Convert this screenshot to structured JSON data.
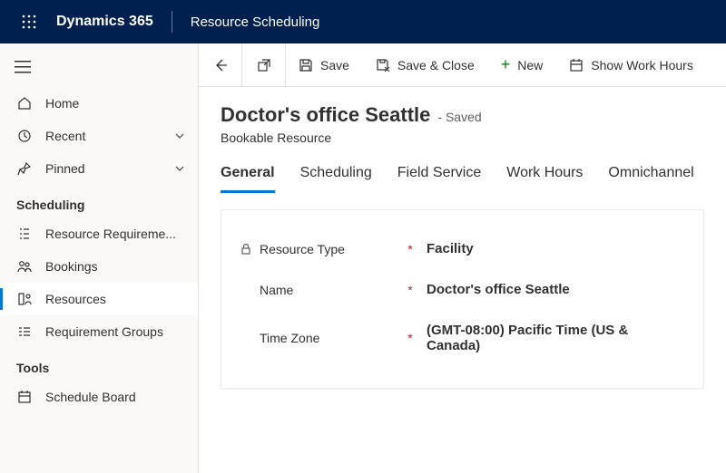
{
  "topbar": {
    "brand": "Dynamics 365",
    "app": "Resource Scheduling"
  },
  "sidebar": {
    "home": "Home",
    "recent": "Recent",
    "pinned": "Pinned",
    "section_scheduling": "Scheduling",
    "resource_requirements": "Resource Requireme...",
    "bookings": "Bookings",
    "resources": "Resources",
    "requirement_groups": "Requirement Groups",
    "section_tools": "Tools",
    "schedule_board": "Schedule Board"
  },
  "cmdbar": {
    "save": "Save",
    "save_close": "Save & Close",
    "new": "New",
    "show_work_hours": "Show Work Hours"
  },
  "record": {
    "title": "Doctor's office Seattle",
    "status": "- Saved",
    "entity": "Bookable Resource"
  },
  "tabs": {
    "general": "General",
    "scheduling": "Scheduling",
    "field_service": "Field Service",
    "work_hours": "Work Hours",
    "omnichannel": "Omnichannel"
  },
  "form": {
    "resource_type_label": "Resource Type",
    "resource_type_value": "Facility",
    "name_label": "Name",
    "name_value": "Doctor's office Seattle",
    "timezone_label": "Time Zone",
    "timezone_value": "(GMT-08:00) Pacific Time (US & Canada)"
  }
}
